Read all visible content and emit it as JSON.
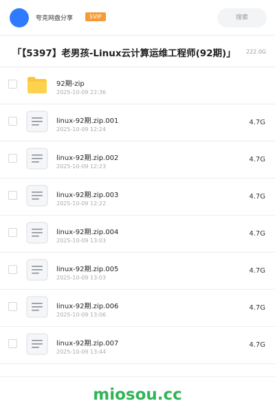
{
  "header": {
    "app_name": "夸克网盘分享",
    "badge": "SVIP",
    "search_placeholder": "搜索",
    "avatar_color": "#2f7bff",
    "badge_color": "#f29c38"
  },
  "share": {
    "title": "「【5397】老男孩-Linux云计算运维工程师(92期)」",
    "total_size": "222.0G"
  },
  "files": [
    {
      "type": "folder",
      "icon": "folder-icon",
      "name": "92期-zip",
      "date": "2025-10-09 22:36",
      "size": ""
    },
    {
      "type": "file",
      "icon": "document-icon",
      "name": "linux-92期.zip.001",
      "date": "2025-10-09 12:24",
      "size": "4.7G"
    },
    {
      "type": "file",
      "icon": "document-icon",
      "name": "linux-92期.zip.002",
      "date": "2025-10-09 12:23",
      "size": "4.7G"
    },
    {
      "type": "file",
      "icon": "document-icon",
      "name": "linux-92期.zip.003",
      "date": "2025-10-09 12:22",
      "size": "4.7G"
    },
    {
      "type": "file",
      "icon": "document-icon",
      "name": "linux-92期.zip.004",
      "date": "2025-10-09 13:03",
      "size": "4.7G"
    },
    {
      "type": "file",
      "icon": "document-icon",
      "name": "linux-92期.zip.005",
      "date": "2025-10-09 13:03",
      "size": "4.7G"
    },
    {
      "type": "file",
      "icon": "document-icon",
      "name": "linux-92期.zip.006",
      "date": "2025-10-09 13:06",
      "size": "4.7G"
    },
    {
      "type": "file",
      "icon": "document-icon",
      "name": "linux-92期.zip.007",
      "date": "2025-10-09 13:44",
      "size": "4.7G"
    }
  ],
  "footer": {
    "watermark": "miosou.cc",
    "watermark_color": "#2fb556"
  }
}
